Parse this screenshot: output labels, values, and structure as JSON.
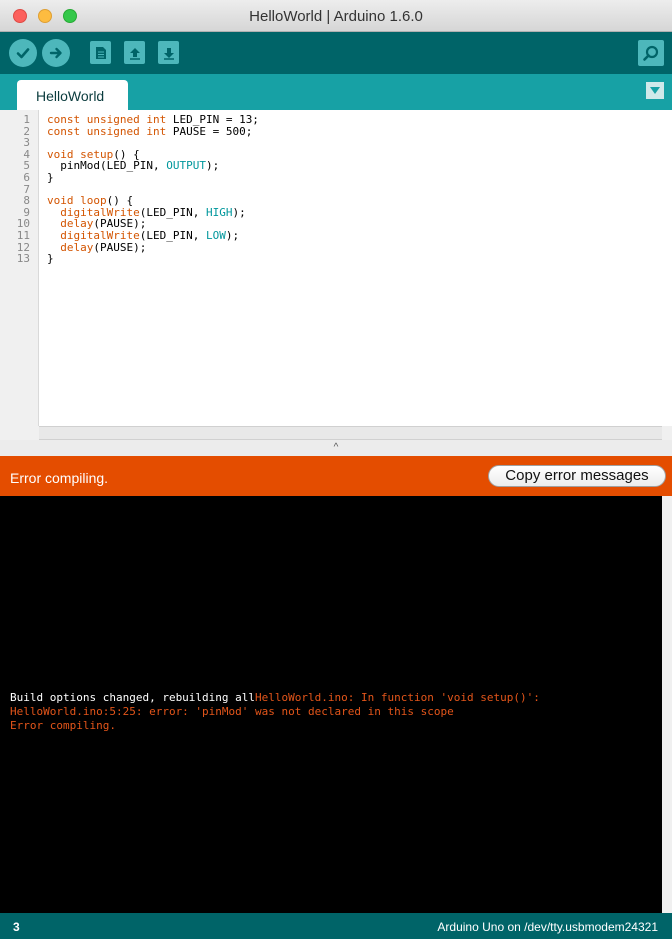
{
  "window": {
    "title": "HelloWorld | Arduino 1.6.0"
  },
  "toolbar": {
    "buttons": [
      "verify-icon",
      "upload-icon",
      "new-icon",
      "open-icon",
      "save-icon"
    ],
    "serial_monitor_icon": "serial-monitor-icon"
  },
  "tabs": [
    {
      "label": "HelloWorld"
    }
  ],
  "editor": {
    "line_numbers": [
      "1",
      "2",
      "3",
      "4",
      "5",
      "6",
      "7",
      "8",
      "9",
      "10",
      "11",
      "12",
      "13"
    ],
    "lines": [
      [
        {
          "t": "const unsigned int",
          "c": "kw"
        },
        {
          "t": " LED_PIN = 13;",
          "c": ""
        }
      ],
      [
        {
          "t": "const unsigned int",
          "c": "kw"
        },
        {
          "t": " PAUSE = 500;",
          "c": ""
        }
      ],
      [],
      [
        {
          "t": "void",
          "c": "kw"
        },
        {
          "t": " ",
          "c": ""
        },
        {
          "t": "setup",
          "c": "fn"
        },
        {
          "t": "() {",
          "c": ""
        }
      ],
      [
        {
          "t": "  pinMod(LED_PIN, ",
          "c": ""
        },
        {
          "t": "OUTPUT",
          "c": "cst"
        },
        {
          "t": ");",
          "c": ""
        }
      ],
      [
        {
          "t": "}",
          "c": ""
        }
      ],
      [],
      [
        {
          "t": "void",
          "c": "kw"
        },
        {
          "t": " ",
          "c": ""
        },
        {
          "t": "loop",
          "c": "fn"
        },
        {
          "t": "() {",
          "c": ""
        }
      ],
      [
        {
          "t": "  ",
          "c": ""
        },
        {
          "t": "digitalWrite",
          "c": "fn"
        },
        {
          "t": "(LED_PIN, ",
          "c": ""
        },
        {
          "t": "HIGH",
          "c": "cst"
        },
        {
          "t": ");",
          "c": ""
        }
      ],
      [
        {
          "t": "  ",
          "c": ""
        },
        {
          "t": "delay",
          "c": "fn"
        },
        {
          "t": "(PAUSE);",
          "c": ""
        }
      ],
      [
        {
          "t": "  ",
          "c": ""
        },
        {
          "t": "digitalWrite",
          "c": "fn"
        },
        {
          "t": "(LED_PIN, ",
          "c": ""
        },
        {
          "t": "LOW",
          "c": "cst"
        },
        {
          "t": ");",
          "c": ""
        }
      ],
      [
        {
          "t": "  ",
          "c": ""
        },
        {
          "t": "delay",
          "c": "fn"
        },
        {
          "t": "(PAUSE);",
          "c": ""
        }
      ],
      [
        {
          "t": "}",
          "c": ""
        }
      ]
    ]
  },
  "split_handle": "^",
  "error_bar": {
    "message": "Error compiling.",
    "copy_button": "Copy error messages"
  },
  "console": {
    "lines": [
      [
        {
          "t": "Build options changed, rebuilding all",
          "c": "white"
        },
        {
          "t": "HelloWorld.ino: In function 'void setup()':",
          "c": "orange"
        }
      ],
      [
        {
          "t": "HelloWorld.ino:5:25: error: 'pinMod' was not declared in this scope",
          "c": "orange"
        }
      ],
      [
        {
          "t": "Error compiling.",
          "c": "orange"
        }
      ]
    ]
  },
  "status": {
    "line": "3",
    "board": "Arduino Uno on /dev/tty.usbmodem24321"
  },
  "colors": {
    "toolbar": "#006468",
    "tabbar": "#17a1a5",
    "error_bar": "#e44d00",
    "console_error": "#e3551a"
  }
}
